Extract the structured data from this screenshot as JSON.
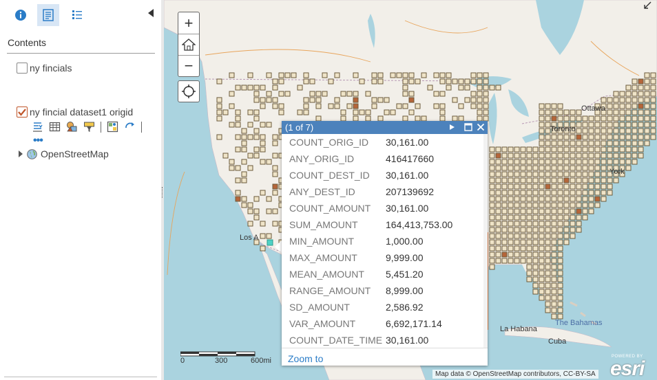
{
  "sidebar": {
    "tabs": [
      {
        "name": "details",
        "icon": "info-icon"
      },
      {
        "name": "contents",
        "icon": "contents-icon"
      },
      {
        "name": "legend",
        "icon": "legend-icon"
      }
    ],
    "contents_title": "Contents",
    "layers": [
      {
        "label": "ny fincials",
        "checked": false
      },
      {
        "label": "ny fincial dataset1 origid",
        "checked": true
      }
    ],
    "layer_tools": [
      "show-table-icon",
      "attribute-table-icon",
      "change-style-icon",
      "filter-icon",
      "analysis-icon",
      "refresh-icon"
    ],
    "more": "•••",
    "basemap": {
      "label": "OpenStreetMap"
    }
  },
  "map": {
    "labels": {
      "ottawa": "Ottawa",
      "toronto": "Toronto",
      "york": "York",
      "los_angeles": "Los A",
      "la_habana": "La Habana",
      "cuba": "Cuba",
      "bahamas": "The Bahamas"
    },
    "scale": {
      "zero": "0",
      "mid": "300",
      "max": "600mi"
    },
    "attribution": "Map data © OpenStreetMap contributors, CC-BY-SA",
    "esri": {
      "powered": "POWERED BY",
      "logo": "esri"
    },
    "colors": {
      "water": "#aad3df",
      "land": "#f2efe9",
      "grid_cell": "#efe4c8",
      "grid_stroke": "#6b5a3a",
      "hotspot": "#b5653a"
    }
  },
  "popup": {
    "title": "(1 of 7)",
    "attributes": [
      {
        "name": "COUNT_ORIG_ID",
        "value": "30,161.00"
      },
      {
        "name": "ANY_ORIG_ID",
        "value": "416417660"
      },
      {
        "name": "COUNT_DEST_ID",
        "value": "30,161.00"
      },
      {
        "name": "ANY_DEST_ID",
        "value": "207139692"
      },
      {
        "name": "COUNT_AMOUNT",
        "value": "30,161.00"
      },
      {
        "name": "SUM_AMOUNT",
        "value": "164,413,753.00"
      },
      {
        "name": "MIN_AMOUNT",
        "value": "1,000.00"
      },
      {
        "name": "MAX_AMOUNT",
        "value": "9,999.00"
      },
      {
        "name": "MEAN_AMOUNT",
        "value": "5,451.20"
      },
      {
        "name": "RANGE_AMOUNT",
        "value": "8,999.00"
      },
      {
        "name": "SD_AMOUNT",
        "value": "2,586.92"
      },
      {
        "name": "VAR_AMOUNT",
        "value": "6,692,171.14"
      },
      {
        "name": "COUNT_DATE_TIME",
        "value": "30,161.00"
      }
    ],
    "zoom_to": "Zoom to"
  }
}
